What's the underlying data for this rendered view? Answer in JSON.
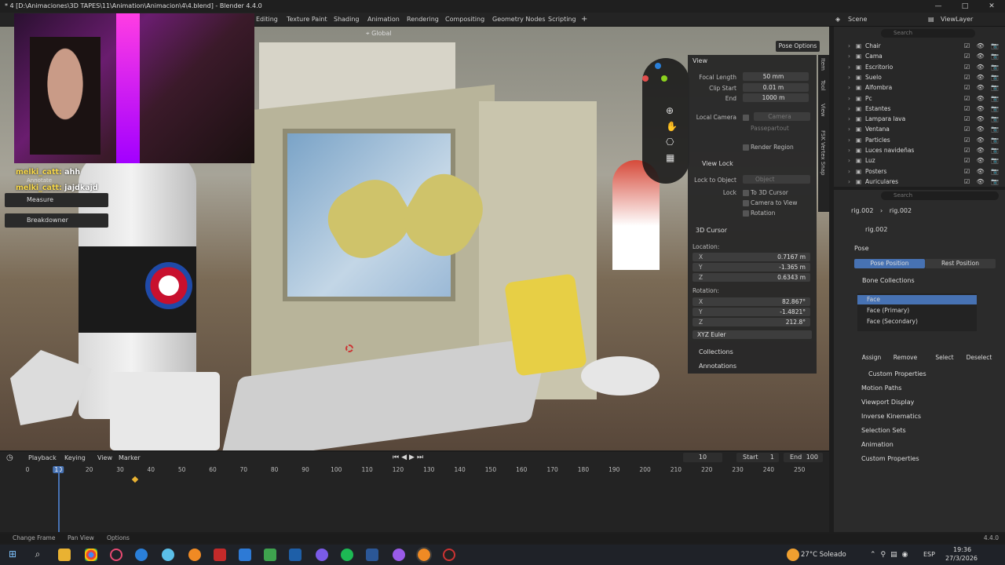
{
  "titlebar": {
    "title": "* 4 [D:\\Animaciones\\3D TAPES\\11\\Animation\\Animacion\\4\\4.blend] - Blender 4.4.0",
    "minimize": "—",
    "maximize": "□",
    "close": "✕"
  },
  "workspaces": [
    "Editing",
    "Texture Paint",
    "Shading",
    "Animation",
    "Rendering",
    "Compositing",
    "Geometry Nodes",
    "Scripting",
    "+"
  ],
  "scene": {
    "scene_label": "Scene",
    "view_layer_label": "ViewLayer"
  },
  "viewport_header": {
    "transform": "Global",
    "pose_options": "Pose Options"
  },
  "chat": [
    {
      "user": "melki_catt:",
      "msg": "ahh"
    },
    {
      "user": "melki_catt:",
      "msg": "jajdkajd"
    }
  ],
  "tools": {
    "annotate": "Annotate",
    "measure": "Measure",
    "breakdowner": "Breakdowner"
  },
  "npanel": {
    "view_title": "View",
    "focal_length_label": "Focal Length",
    "focal_length": "50 mm",
    "clip_start_label": "Clip Start",
    "clip_start": "0.01 m",
    "end_label": "End",
    "end": "1000 m",
    "local_camera_label": "Local Camera",
    "camera_placeholder": "Camera",
    "passepartout": "Passepartout",
    "render_region": "Render Region",
    "view_lock_title": "View Lock",
    "lock_to_object_label": "Lock to Object",
    "object_placeholder": "Object",
    "lock_label": "Lock",
    "to_3d_cursor": "To 3D Cursor",
    "camera_to_view": "Camera to View",
    "rotation_cb": "Rotation",
    "cursor_title": "3D Cursor",
    "location_label": "Location:",
    "loc_x": "0.7167 m",
    "loc_y": "-1.365 m",
    "loc_z": "0.6343 m",
    "rotation_label": "Rotation:",
    "rot_x": "82.867°",
    "rot_y": "-1.4821°",
    "rot_z": "212.8°",
    "euler": "XYZ Euler",
    "collections": "Collections",
    "annotations": "Annotations",
    "tabs": [
      "Item",
      "Tool",
      "View",
      "FSK Vertex Snap"
    ]
  },
  "outliner": {
    "search_placeholder": "Search",
    "items": [
      "Chair",
      "Cama",
      "Escritorio",
      "Suelo",
      "Alfombra",
      "Pc",
      "Estantes",
      "Lampara lava",
      "Ventana",
      "Particles",
      "Luces navideñas",
      "Luz",
      "Posters",
      "Auriculares"
    ]
  },
  "properties": {
    "search_placeholder": "Search",
    "breadcrumb_a": "rig.002",
    "breadcrumb_b": "rig.002",
    "object_name": "rig.002",
    "pose_title": "Pose",
    "pose_position": "Pose Position",
    "rest_position": "Rest Position",
    "bone_collections": "Bone Collections",
    "collections": [
      "Face",
      "Face (Primary)",
      "Face (Secondary)"
    ],
    "assign": "Assign",
    "remove": "Remove",
    "select": "Select",
    "deselect": "Deselect",
    "custom_props_sub": "Custom Properties",
    "sections": [
      "Motion Paths",
      "Viewport Display",
      "Inverse Kinematics",
      "Selection Sets",
      "Animation",
      "Custom Properties"
    ]
  },
  "timeline": {
    "playback": "Playback",
    "keying": "Keying",
    "view": "View",
    "marker": "Marker",
    "current_frame": "10",
    "start_label": "Start",
    "start": "1",
    "end_label": "End",
    "end": "100",
    "ticks": [
      "0",
      "10",
      "20",
      "30",
      "40",
      "50",
      "60",
      "70",
      "80",
      "90",
      "100",
      "110",
      "120",
      "130",
      "140",
      "150",
      "160",
      "170",
      "180",
      "190",
      "200",
      "210",
      "220",
      "230",
      "240",
      "250"
    ]
  },
  "statusbar": {
    "change_frame": "Change Frame",
    "pan_view": "Pan View",
    "options": "Options",
    "version": "4.4.0"
  },
  "taskbar": {
    "weather": "27°C Soleado",
    "lang": "ESP",
    "time": "19:36",
    "date": "27/3/2026"
  },
  "colors": {
    "accent": "#4772b3",
    "bg": "#1d1d1d",
    "panel": "#2b2b2b"
  }
}
